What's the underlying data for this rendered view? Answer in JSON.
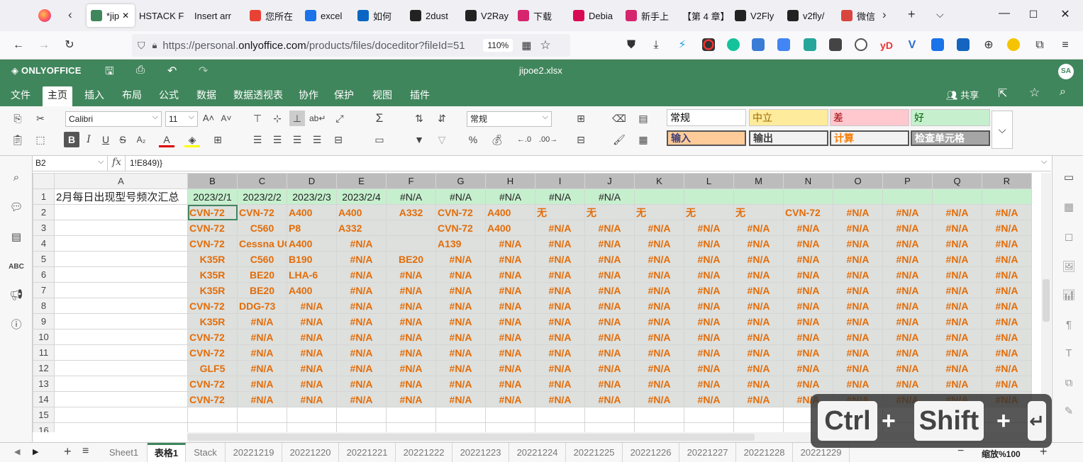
{
  "browser": {
    "tabs": [
      {
        "label": "*jip",
        "favicon": "spreadsheet-favicon",
        "color": "#40865c",
        "active": true
      },
      {
        "label": "HSTACK F",
        "favicon": "",
        "color": ""
      },
      {
        "label": "Insert arr",
        "favicon": "",
        "color": ""
      },
      {
        "label": "您所在",
        "favicon": "map-pin-favicon",
        "color": "#e94235"
      },
      {
        "label": "excel",
        "favicon": "search-favicon",
        "color": "#1a73e8"
      },
      {
        "label": "如何",
        "favicon": "zhihu-favicon",
        "color": "#0a66c2"
      },
      {
        "label": "2dust",
        "favicon": "github-favicon",
        "color": "#222222"
      },
      {
        "label": "V2Ray",
        "favicon": "v-favicon",
        "color": "#222222"
      },
      {
        "label": "下载",
        "favicon": "cactus-favicon",
        "color": "#d6246e"
      },
      {
        "label": "Debia",
        "favicon": "debian-favicon",
        "color": "#d70a53"
      },
      {
        "label": "新手上",
        "favicon": "cactus-favicon",
        "color": "#d6246e"
      },
      {
        "label": "【第 4 章】",
        "favicon": "",
        "color": ""
      },
      {
        "label": "V2Fly",
        "favicon": "github-favicon",
        "color": "#222222"
      },
      {
        "label": "v2fly/",
        "favicon": "github-favicon",
        "color": "#222222"
      },
      {
        "label": "微信",
        "favicon": "wechat-favicon",
        "color": "#d9463e"
      }
    ],
    "url_prefix": "https://personal.",
    "url_domain": "onlyoffice.com",
    "url_rest": "/products/files/doceditor?fileId=51",
    "zoom": "110%"
  },
  "app": {
    "brand": "ONLYOFFICE",
    "filename": "jipoe2.xlsx",
    "avatar": "SA",
    "share": "共享",
    "menu": [
      "文件",
      "主页",
      "插入",
      "布局",
      "公式",
      "数据",
      "数据透视表",
      "协作",
      "保护",
      "视图",
      "插件"
    ],
    "active_menu": 1
  },
  "toolbar": {
    "font": "Calibri",
    "size": "11",
    "number_format": "常规",
    "styles": [
      {
        "label": "常规",
        "bg": "#ffffff",
        "fg": "#000000"
      },
      {
        "label": "中立",
        "bg": "#ffeb9c",
        "fg": "#9c6500"
      },
      {
        "label": "差",
        "bg": "#ffc7ce",
        "fg": "#9c0006"
      },
      {
        "label": "好",
        "bg": "#c6efce",
        "fg": "#006100"
      },
      {
        "label": "输入",
        "bg": "#ffcc99",
        "fg": "#3f3f76"
      },
      {
        "label": "输出",
        "bg": "#f2f2f2",
        "fg": "#3f3f3f"
      },
      {
        "label": "计算",
        "bg": "#f2f2f2",
        "fg": "#fa7d00"
      },
      {
        "label": "检查单元格",
        "bg": "#a5a5a5",
        "fg": "#ffffff"
      }
    ]
  },
  "formula": {
    "cell_ref": "B2",
    "fx": "fx",
    "content": "1!E849)}"
  },
  "grid": {
    "columns": [
      "A",
      "B",
      "C",
      "D",
      "E",
      "F",
      "G",
      "H",
      "I",
      "J",
      "K",
      "L",
      "M",
      "N",
      "O",
      "P",
      "Q",
      "R"
    ],
    "header_row": [
      "2月每日出现型号频次汇总",
      "2023/2/1",
      "2023/2/2",
      "2023/2/3",
      "2023/2/4",
      "#N/A",
      "#N/A",
      "#N/A",
      "#N/A",
      "#N/A",
      "",
      "",
      "",
      "",
      "",
      "",
      "",
      ""
    ],
    "rows": [
      [
        "CVN-72",
        "CVN-72",
        "A400",
        "A400",
        "A332",
        "CVN-72",
        "A400",
        "无",
        "无",
        "无",
        "无",
        "无",
        "CVN-72",
        "#N/A",
        "#N/A",
        "#N/A",
        "#N/A"
      ],
      [
        "CVN-72",
        "C560",
        "P8",
        "A332",
        "",
        "CVN-72",
        "A400",
        "#N/A",
        "#N/A",
        "#N/A",
        "#N/A",
        "#N/A",
        "#N/A",
        "#N/A",
        "#N/A",
        "#N/A",
        "#N/A"
      ],
      [
        "CVN-72",
        "Cessna UC",
        "A400",
        "#N/A",
        "",
        "A139",
        "#N/A",
        "#N/A",
        "#N/A",
        "#N/A",
        "#N/A",
        "#N/A",
        "#N/A",
        "#N/A",
        "#N/A",
        "#N/A",
        "#N/A"
      ],
      [
        "K35R",
        "C560",
        "B190",
        "#N/A",
        "BE20",
        "#N/A",
        "#N/A",
        "#N/A",
        "#N/A",
        "#N/A",
        "#N/A",
        "#N/A",
        "#N/A",
        "#N/A",
        "#N/A",
        "#N/A",
        "#N/A"
      ],
      [
        "K35R",
        "BE20",
        "LHA-6",
        "#N/A",
        "#N/A",
        "#N/A",
        "#N/A",
        "#N/A",
        "#N/A",
        "#N/A",
        "#N/A",
        "#N/A",
        "#N/A",
        "#N/A",
        "#N/A",
        "#N/A",
        "#N/A"
      ],
      [
        "K35R",
        "BE20",
        "A400",
        "#N/A",
        "#N/A",
        "#N/A",
        "#N/A",
        "#N/A",
        "#N/A",
        "#N/A",
        "#N/A",
        "#N/A",
        "#N/A",
        "#N/A",
        "#N/A",
        "#N/A",
        "#N/A"
      ],
      [
        "CVN-72",
        "DDG-73",
        "#N/A",
        "#N/A",
        "#N/A",
        "#N/A",
        "#N/A",
        "#N/A",
        "#N/A",
        "#N/A",
        "#N/A",
        "#N/A",
        "#N/A",
        "#N/A",
        "#N/A",
        "#N/A",
        "#N/A"
      ],
      [
        "K35R",
        "#N/A",
        "#N/A",
        "#N/A",
        "#N/A",
        "#N/A",
        "#N/A",
        "#N/A",
        "#N/A",
        "#N/A",
        "#N/A",
        "#N/A",
        "#N/A",
        "#N/A",
        "#N/A",
        "#N/A",
        "#N/A"
      ],
      [
        "CVN-72",
        "#N/A",
        "#N/A",
        "#N/A",
        "#N/A",
        "#N/A",
        "#N/A",
        "#N/A",
        "#N/A",
        "#N/A",
        "#N/A",
        "#N/A",
        "#N/A",
        "#N/A",
        "#N/A",
        "#N/A",
        "#N/A"
      ],
      [
        "CVN-72",
        "#N/A",
        "#N/A",
        "#N/A",
        "#N/A",
        "#N/A",
        "#N/A",
        "#N/A",
        "#N/A",
        "#N/A",
        "#N/A",
        "#N/A",
        "#N/A",
        "#N/A",
        "#N/A",
        "#N/A",
        "#N/A"
      ],
      [
        "GLF5",
        "#N/A",
        "#N/A",
        "#N/A",
        "#N/A",
        "#N/A",
        "#N/A",
        "#N/A",
        "#N/A",
        "#N/A",
        "#N/A",
        "#N/A",
        "#N/A",
        "#N/A",
        "#N/A",
        "#N/A",
        "#N/A"
      ],
      [
        "CVN-72",
        "#N/A",
        "#N/A",
        "#N/A",
        "#N/A",
        "#N/A",
        "#N/A",
        "#N/A",
        "#N/A",
        "#N/A",
        "#N/A",
        "#N/A",
        "#N/A",
        "#N/A",
        "#N/A",
        "#N/A",
        "#N/A"
      ],
      [
        "CVN-72",
        "#N/A",
        "#N/A",
        "#N/A",
        "#N/A",
        "#N/A",
        "#N/A",
        "#N/A",
        "#N/A",
        "#N/A",
        "#N/A",
        "#N/A",
        "#N/A",
        "#N/A",
        "#N/A",
        "#N/A",
        "#N/A"
      ]
    ],
    "row_numbers": [
      "1",
      "2",
      "3",
      "4",
      "5",
      "6",
      "7",
      "8",
      "9",
      "10",
      "11",
      "12",
      "13",
      "14",
      "15",
      "16"
    ]
  },
  "sheets": {
    "tabs": [
      "Sheet1",
      "表格1",
      "Stack",
      "20221219",
      "20221220",
      "20221221",
      "20221222",
      "20221223",
      "20221224",
      "20221225",
      "20221226",
      "20221227",
      "20221228",
      "20221229"
    ],
    "active": 1,
    "zoom_label": "缩放%100"
  },
  "overlay": {
    "keys": [
      "Ctrl",
      "+",
      "Shift",
      "+",
      "↵"
    ]
  }
}
